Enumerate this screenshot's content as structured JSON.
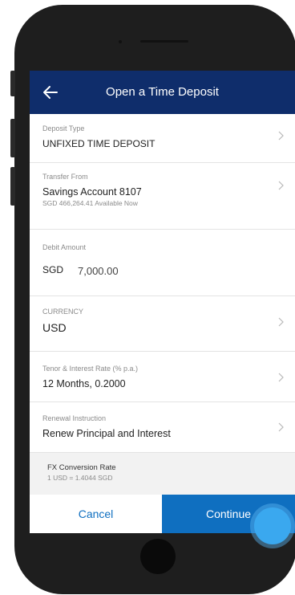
{
  "header": {
    "title": "Open a Time Deposit"
  },
  "fields": {
    "deposit_type": {
      "label": "Deposit Type",
      "value": "UNFIXED TIME DEPOSIT"
    },
    "transfer_from": {
      "label": "Transfer From",
      "value": "Savings Account 8107",
      "available": "SGD 466,264.41 Available Now"
    },
    "debit_amount": {
      "label": "Debit Amount",
      "currency": "SGD",
      "amount": "7,000.00"
    },
    "currency": {
      "label": "CURRENCY",
      "value": "USD"
    },
    "tenor": {
      "label": "Tenor & Interest Rate (% p.a.)",
      "value": "12 Months, 0.2000"
    },
    "renewal": {
      "label": "Renewal Instruction",
      "value": "Renew Principal and Interest"
    }
  },
  "fx": {
    "label": "FX Conversion Rate",
    "value": "1 USD = 1.4044 SGD"
  },
  "actions": {
    "cancel_label": "Cancel",
    "continue_label": "Continue"
  },
  "colors": {
    "header_bg": "#0f2d6b",
    "primary": "#0f6fc0",
    "touch_indicator": "#3aa8ef"
  }
}
